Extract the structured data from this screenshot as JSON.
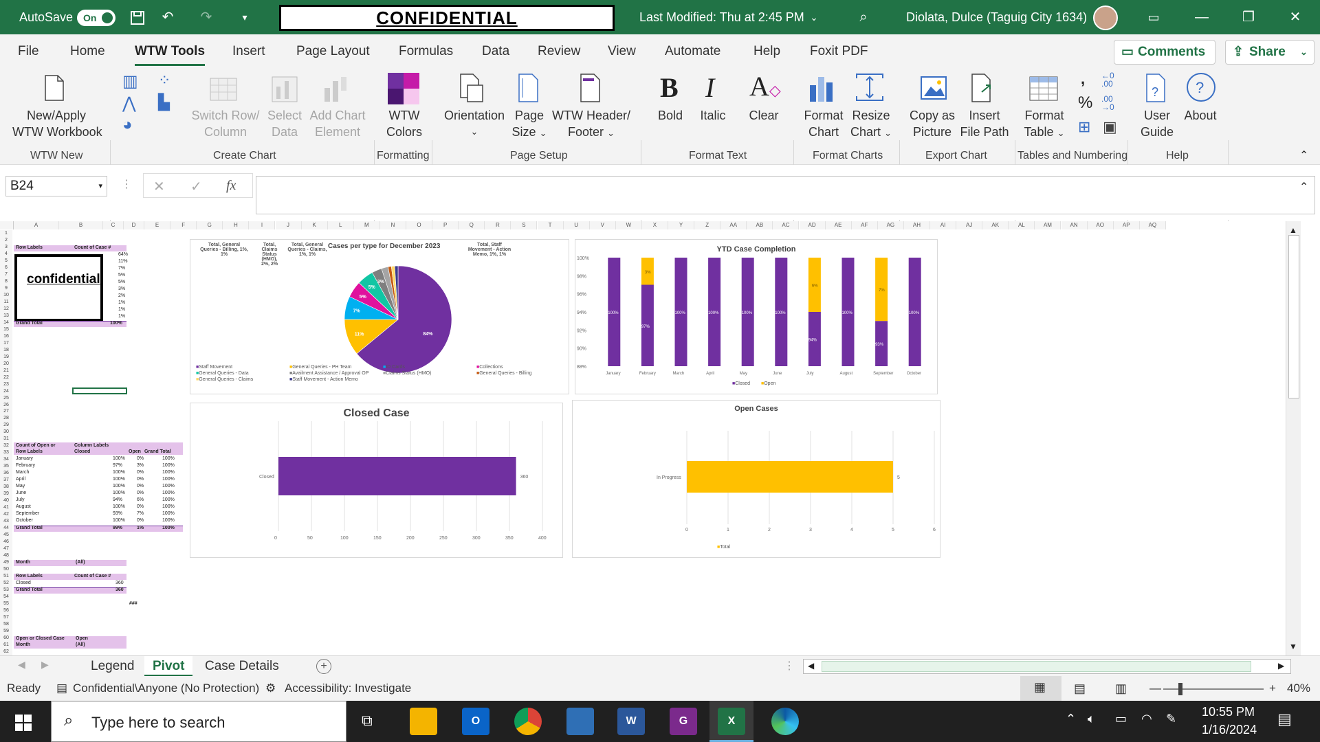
{
  "titlebar": {
    "autosave_label": "AutoSave",
    "autosave_state": "On",
    "confidential_label": "CONFIDENTIAL",
    "last_modified": "Last Modified: Thu at 2:45 PM",
    "user_name": "Diolata, Dulce (Taguig City 1634)"
  },
  "menu": {
    "tabs": [
      "File",
      "Home",
      "WTW Tools",
      "Insert",
      "Page Layout",
      "Formulas",
      "Data",
      "Review",
      "View",
      "Automate",
      "Help",
      "Foxit PDF"
    ],
    "active": "WTW Tools",
    "comments_label": "Comments",
    "share_label": "Share"
  },
  "ribbon": {
    "new_apply": "New/Apply",
    "wtw_workbook": "WTW Workbook",
    "switch_row": "Switch Row/",
    "column": "Column",
    "select": "Select",
    "data": "Data",
    "add_chart": "Add Chart",
    "element": "Element",
    "wtw": "WTW",
    "colors": "Colors",
    "orientation": "Orientation",
    "page": "Page",
    "size": "Size",
    "wtw_header": "WTW Header/",
    "footer": "Footer",
    "bold": "Bold",
    "italic": "Italic",
    "clear": "Clear",
    "format": "Format",
    "chart": "Chart",
    "resize": "Resize",
    "copy_as": "Copy as",
    "picture": "Picture",
    "insert": "Insert",
    "file_path": "File Path",
    "table": "Table",
    "user": "User",
    "guide": "Guide",
    "about": "About",
    "groups": {
      "wtw_new": "WTW New",
      "create_chart": "Create Chart",
      "formatting": "Formatting",
      "page_setup": "Page Setup",
      "format_text": "Format Text",
      "format_charts": "Format Charts",
      "export_chart": "Export Chart",
      "tables_numbering": "Tables and Numbering",
      "help": "Help"
    }
  },
  "formula_bar": {
    "name_box": "B24",
    "cancel": "✕",
    "enter": "✓",
    "fx": "fx"
  },
  "sheet": {
    "columns": [
      "A",
      "B",
      "C",
      "D",
      "E",
      "F",
      "G",
      "H",
      "I",
      "J",
      "K",
      "L",
      "M",
      "N",
      "O",
      "P",
      "Q",
      "R",
      "S",
      "T",
      "U",
      "V",
      "W",
      "X",
      "Y",
      "Z",
      "AA",
      "AB",
      "AC",
      "AD",
      "AE",
      "AF",
      "AG",
      "AH",
      "AI",
      "AJ",
      "AK",
      "AL",
      "AM",
      "AN",
      "AO",
      "AP",
      "AQ"
    ],
    "pivot1": {
      "h1": "Row Labels",
      "h2": "Count of Case #",
      "confidential": "confidential",
      "values": [
        "64%",
        "11%",
        "7%",
        "5%",
        "5%",
        "3%",
        "2%",
        "1%",
        "1%",
        "1%"
      ],
      "total_label": "Grand Total",
      "total_value": "100%"
    },
    "pivot2": {
      "h1": "Count of Open or",
      "h2": "Column Labels",
      "row_labels": "Row Labels",
      "closed": "Closed",
      "open": "Open",
      "grand_total": "Grand Total",
      "rows": [
        [
          "January",
          "100%",
          "0%",
          "100%"
        ],
        [
          "February",
          "97%",
          "3%",
          "100%"
        ],
        [
          "March",
          "100%",
          "0%",
          "100%"
        ],
        [
          "April",
          "100%",
          "0%",
          "100%"
        ],
        [
          "May",
          "100%",
          "0%",
          "100%"
        ],
        [
          "June",
          "100%",
          "0%",
          "100%"
        ],
        [
          "July",
          "94%",
          "6%",
          "100%"
        ],
        [
          "August",
          "100%",
          "0%",
          "100%"
        ],
        [
          "September",
          "93%",
          "7%",
          "100%"
        ],
        [
          "October",
          "100%",
          "0%",
          "100%"
        ]
      ],
      "total": [
        "Grand Total",
        "99%",
        "1%",
        "100%"
      ]
    },
    "pivot3": {
      "filter_label": "Month",
      "filter_value": "(All)",
      "h1": "Row Labels",
      "h2": "Count of Case #",
      "row_label": "Closed",
      "row_value": "360",
      "total_label": "Grand Total",
      "total_value": "360",
      "overflow": "###"
    },
    "pivot4": {
      "f1": "Open or Closed Case",
      "v1": "Open",
      "f2": "Month",
      "v2": "(All)"
    }
  },
  "charts": {
    "pie": {
      "title": "Cases per type for December 2023",
      "callouts": [
        "Total, General Queries - Billing, 1%, 1%",
        "Total, Claims Status (HMO), 2%, 2%",
        "Total, General Queries - Claims, 1%, 1%",
        "Total, Staff Movement - Action Memo, 1%, 1%"
      ],
      "legend": [
        "Staff Movement",
        "General Queries - PH Team",
        "ID Cards",
        "Collections",
        "General Queries - Data",
        "Availment Assistance / Approval OP",
        "Claims Status (HMO)",
        "General Queries - Billing",
        "General Queries - Claims",
        "Staff Movement - Action Memo"
      ],
      "slice_labels": [
        "84%",
        "11%",
        "7%",
        "5%",
        "5%",
        "3%"
      ]
    },
    "ytd": {
      "title": "YTD Case Completion",
      "yticks": [
        "100%",
        "98%",
        "96%",
        "94%",
        "92%",
        "90%",
        "88%"
      ],
      "legend_closed": "Closed",
      "legend_open": "Open"
    },
    "closed": {
      "title": "Closed Case",
      "category": "Closed",
      "value_label": "360",
      "xticks": [
        "0",
        "50",
        "100",
        "150",
        "200",
        "250",
        "300",
        "350",
        "400"
      ]
    },
    "open": {
      "title": "Open Cases",
      "category": "In Progress",
      "value_label": "5",
      "xticks": [
        "0",
        "1",
        "2",
        "3",
        "4",
        "5",
        "6"
      ],
      "legend": "Total"
    }
  },
  "chart_data": [
    {
      "type": "pie",
      "title": "Cases per type for December 2023",
      "categories": [
        "Staff Movement",
        "General Queries - PH Team",
        "ID Cards",
        "Collections",
        "General Queries - Data",
        "Availment Assistance / Approval OP",
        "Claims Status (HMO)",
        "General Queries - Billing",
        "General Queries - Claims",
        "Staff Movement - Action Memo"
      ],
      "values": [
        64,
        11,
        7,
        5,
        5,
        3,
        2,
        1,
        1,
        1
      ],
      "colors": [
        "#7030a0",
        "#ffc000",
        "#00b0f0",
        "#e0119d",
        "#11c6a4",
        "#7f7f7f",
        "#a5a5a5",
        "#c55a11",
        "#ffd966",
        "#3a3a8c"
      ]
    },
    {
      "type": "bar",
      "title": "YTD Case Completion",
      "categories": [
        "January",
        "February",
        "March",
        "April",
        "May",
        "June",
        "July",
        "August",
        "September",
        "October"
      ],
      "series": [
        {
          "name": "Closed",
          "values": [
            100,
            97,
            100,
            100,
            100,
            100,
            94,
            100,
            93,
            100
          ]
        },
        {
          "name": "Open",
          "values": [
            0,
            3,
            0,
            0,
            0,
            0,
            6,
            0,
            7,
            0
          ]
        }
      ],
      "ylim": [
        88,
        100
      ],
      "stacked": true,
      "colors": [
        "#7030a0",
        "#ffc000"
      ]
    },
    {
      "type": "bar",
      "title": "Closed Case",
      "orientation": "horizontal",
      "categories": [
        "Closed"
      ],
      "values": [
        360
      ],
      "xlim": [
        0,
        400
      ],
      "colors": [
        "#7030a0"
      ]
    },
    {
      "type": "bar",
      "title": "Open Cases",
      "orientation": "horizontal",
      "categories": [
        "In Progress"
      ],
      "series": [
        {
          "name": "Total",
          "values": [
            5
          ]
        }
      ],
      "xlim": [
        0,
        6
      ],
      "colors": [
        "#ffc000"
      ]
    }
  ],
  "sheet_tabs": {
    "tabs": [
      "Legend",
      "Pivot",
      "Case Details"
    ],
    "active": "Pivot"
  },
  "status": {
    "ready": "Ready",
    "sensitivity": "Confidential\\Anyone (No Protection)",
    "accessibility": "Accessibility: Investigate",
    "zoom": "40%"
  },
  "taskbar": {
    "search_placeholder": "Type here to search",
    "time": "10:55 PM",
    "date": "1/16/2024"
  },
  "colors": {
    "excel_green": "#217346",
    "purple": "#7030a0",
    "gold": "#ffc000",
    "pivot_header": "#e4c2ea"
  }
}
